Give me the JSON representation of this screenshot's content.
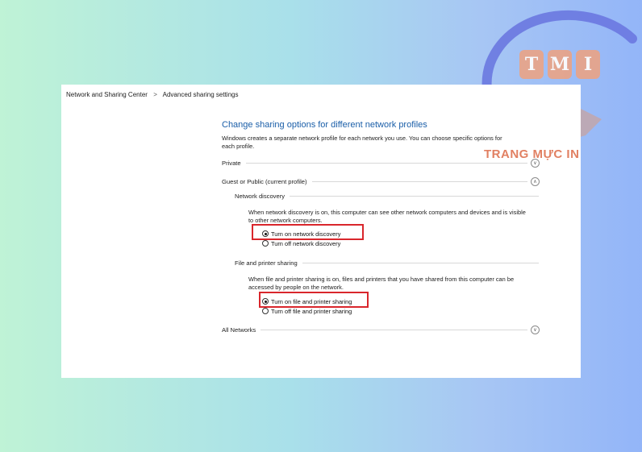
{
  "breadcrumb": {
    "items": [
      "Network and Sharing Center",
      "Advanced sharing settings"
    ],
    "separator": ">"
  },
  "heading": "Change sharing options for different network profiles",
  "description": "Windows creates a separate network profile for each network you use. You can choose specific options for each profile.",
  "profiles": {
    "private": {
      "title": "Private",
      "expanded": false
    },
    "guest_public": {
      "title": "Guest or Public (current profile)",
      "expanded": true,
      "network_discovery": {
        "title": "Network discovery",
        "description": "When network discovery is on, this computer can see other network computers and devices and is visible to other network computers.",
        "options": [
          {
            "label": "Turn on network discovery",
            "selected": true,
            "highlighted": true
          },
          {
            "label": "Turn off network discovery",
            "selected": false
          }
        ]
      },
      "file_printer_sharing": {
        "title": "File and printer sharing",
        "description": "When file and printer sharing is on, files and printers that you have shared from this computer can be accessed by people on the network.",
        "options": [
          {
            "label": "Turn on file and printer sharing",
            "selected": true,
            "highlighted": true
          },
          {
            "label": "Turn off file and printer sharing",
            "selected": false
          }
        ]
      }
    },
    "all_networks": {
      "title": "All Networks",
      "expanded": false
    }
  },
  "watermark": {
    "letters": [
      "T",
      "M",
      "I"
    ],
    "name": "TRANG MỰC IN",
    "colors": {
      "arc": "#6a78e0",
      "letters": "#e9a488",
      "hand": "#d99a82"
    }
  },
  "colors": {
    "heading": "#1a5ea8",
    "highlight_box": "#d9262c",
    "window_bg": "#ffffff"
  }
}
